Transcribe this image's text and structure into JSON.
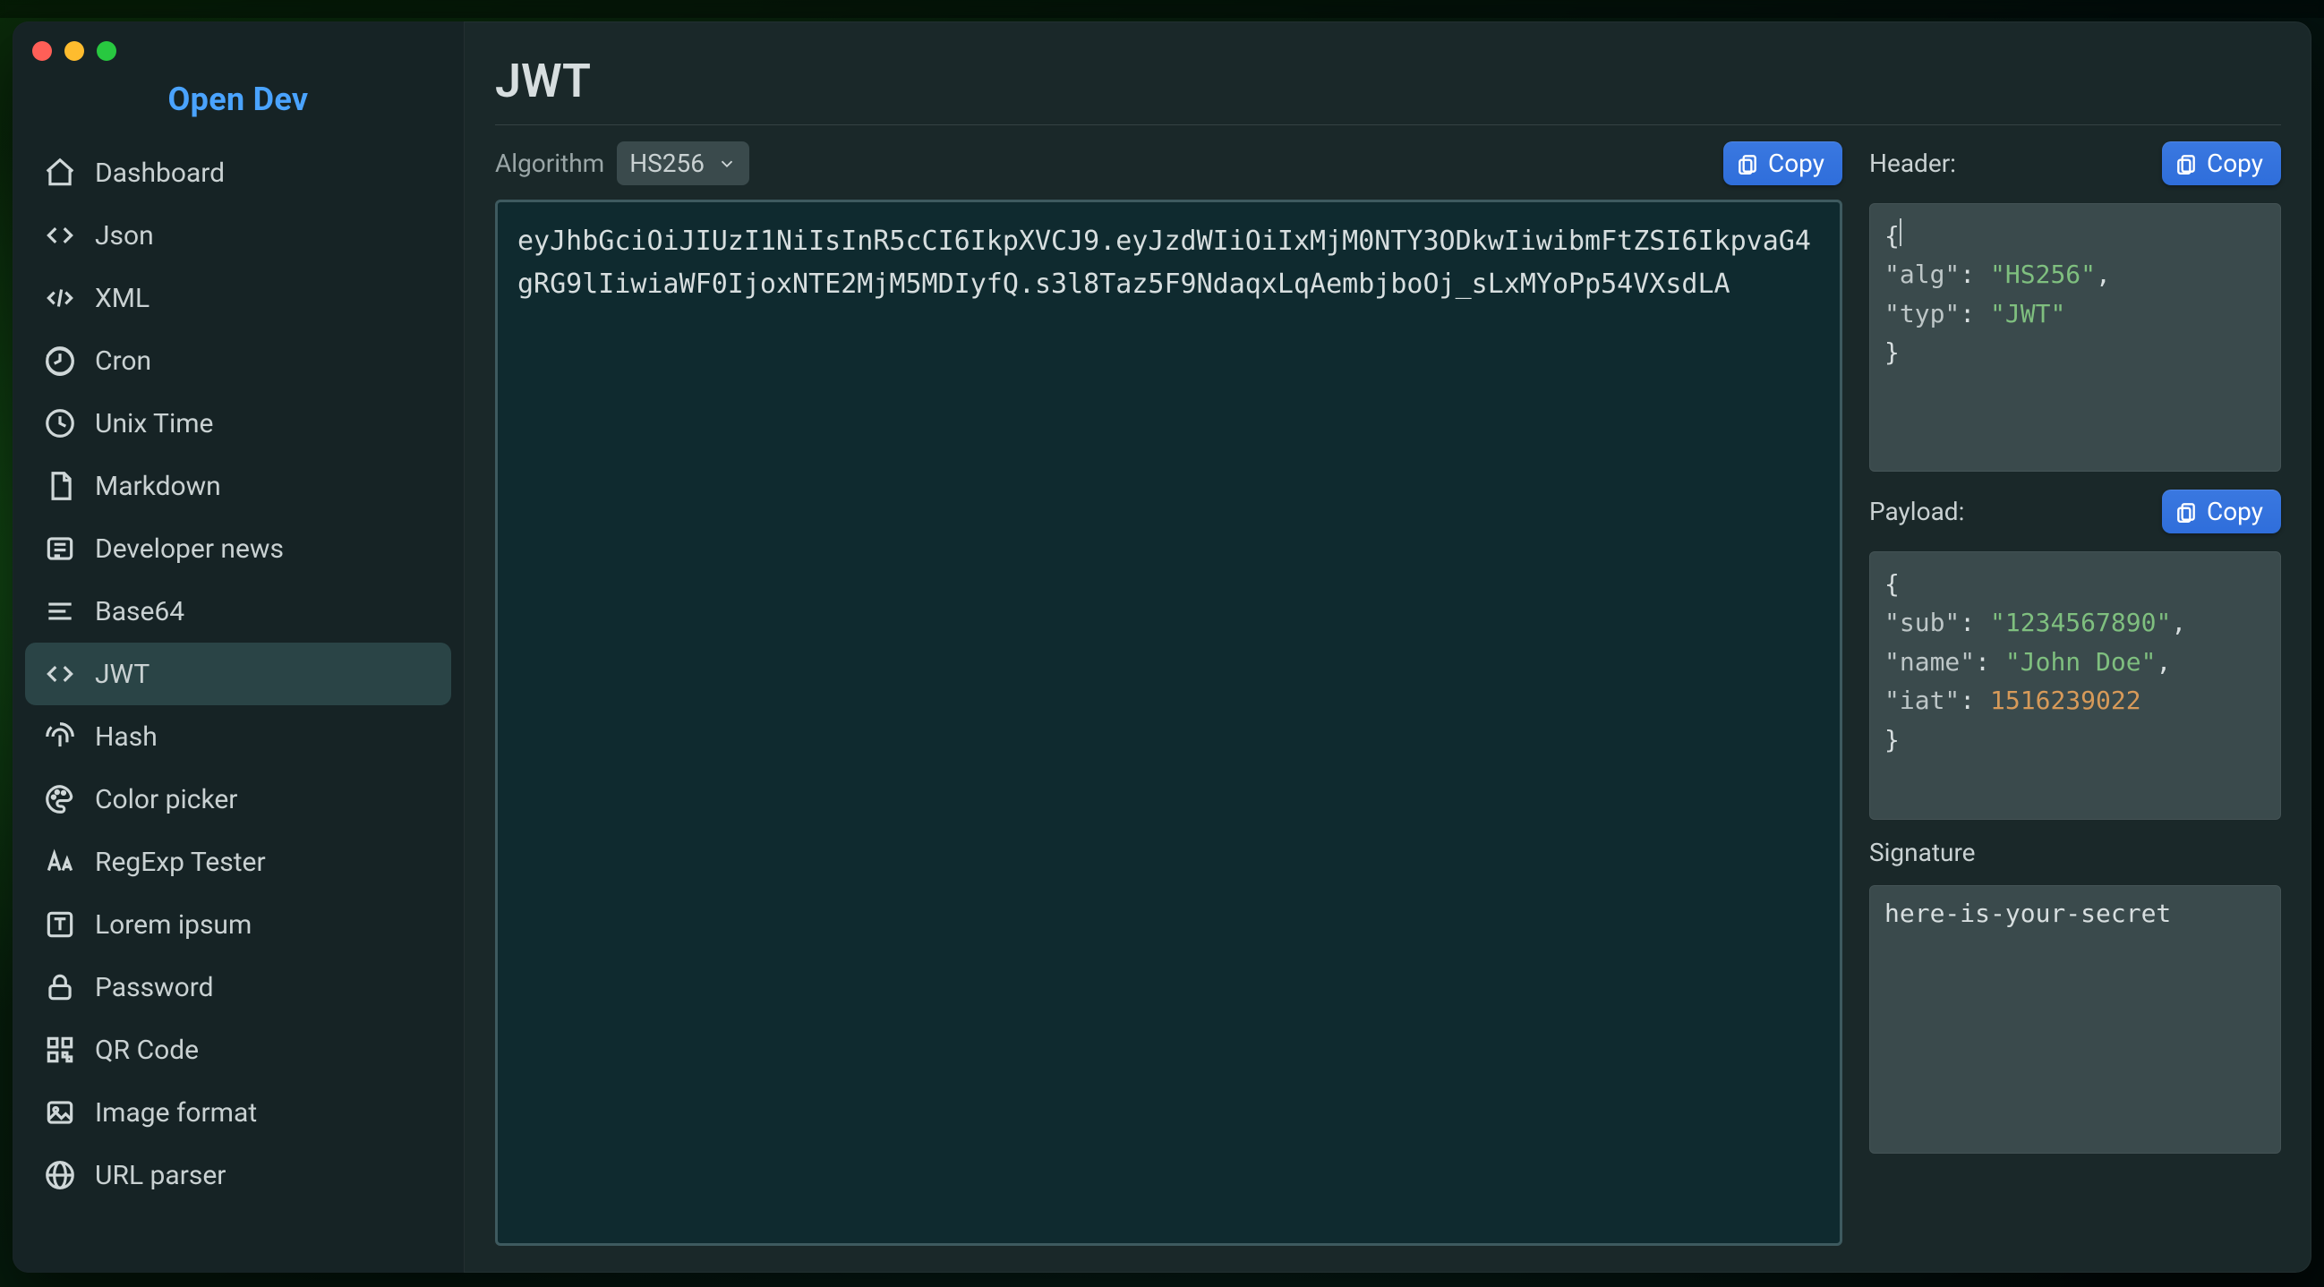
{
  "app_title": "Open Dev",
  "page_title": "JWT",
  "sidebar": {
    "items": [
      {
        "label": "Dashboard",
        "icon": "home"
      },
      {
        "label": "Json",
        "icon": "codebraces"
      },
      {
        "label": "XML",
        "icon": "codeblock"
      },
      {
        "label": "Cron",
        "icon": "history"
      },
      {
        "label": "Unix Time",
        "icon": "clock"
      },
      {
        "label": "Markdown",
        "icon": "doc"
      },
      {
        "label": "Developer news",
        "icon": "news"
      },
      {
        "label": "Base64",
        "icon": "lines"
      },
      {
        "label": "JWT",
        "icon": "codebraces",
        "active": true
      },
      {
        "label": "Hash",
        "icon": "fingerprint"
      },
      {
        "label": "Color picker",
        "icon": "palette"
      },
      {
        "label": "RegExp Tester",
        "icon": "aa"
      },
      {
        "label": "Lorem ipsum",
        "icon": "textframe"
      },
      {
        "label": "Password",
        "icon": "lock"
      },
      {
        "label": "QR Code",
        "icon": "qrcode"
      },
      {
        "label": "Image format",
        "icon": "image"
      },
      {
        "label": "URL parser",
        "icon": "globe"
      }
    ]
  },
  "toolbar": {
    "algorithm_label": "Algorithm",
    "algorithm_value": "HS256",
    "copy_label": "Copy"
  },
  "encoded": "eyJhbGciOiJIUzI1NiIsInR5cCI6IkpXVCJ9.eyJzdWIiOiIxMjM0NTY3ODkwIiwibmFtZSI6IkpvaG4gRG9lIiwiaWF0IjoxNTE2MjM5MDIyfQ.s3l8Taz5F9NdaqxLqAembjboOj_sLxMYoPp54VXsdLA",
  "right": {
    "header_label": "Header:",
    "header_json": {
      "alg": "HS256",
      "typ": "JWT"
    },
    "payload_label": "Payload:",
    "payload_json": {
      "sub": "1234567890",
      "name": "John Doe",
      "iat": 1516239022
    },
    "signature_label": "Signature",
    "signature_value": "here-is-your-secret"
  }
}
